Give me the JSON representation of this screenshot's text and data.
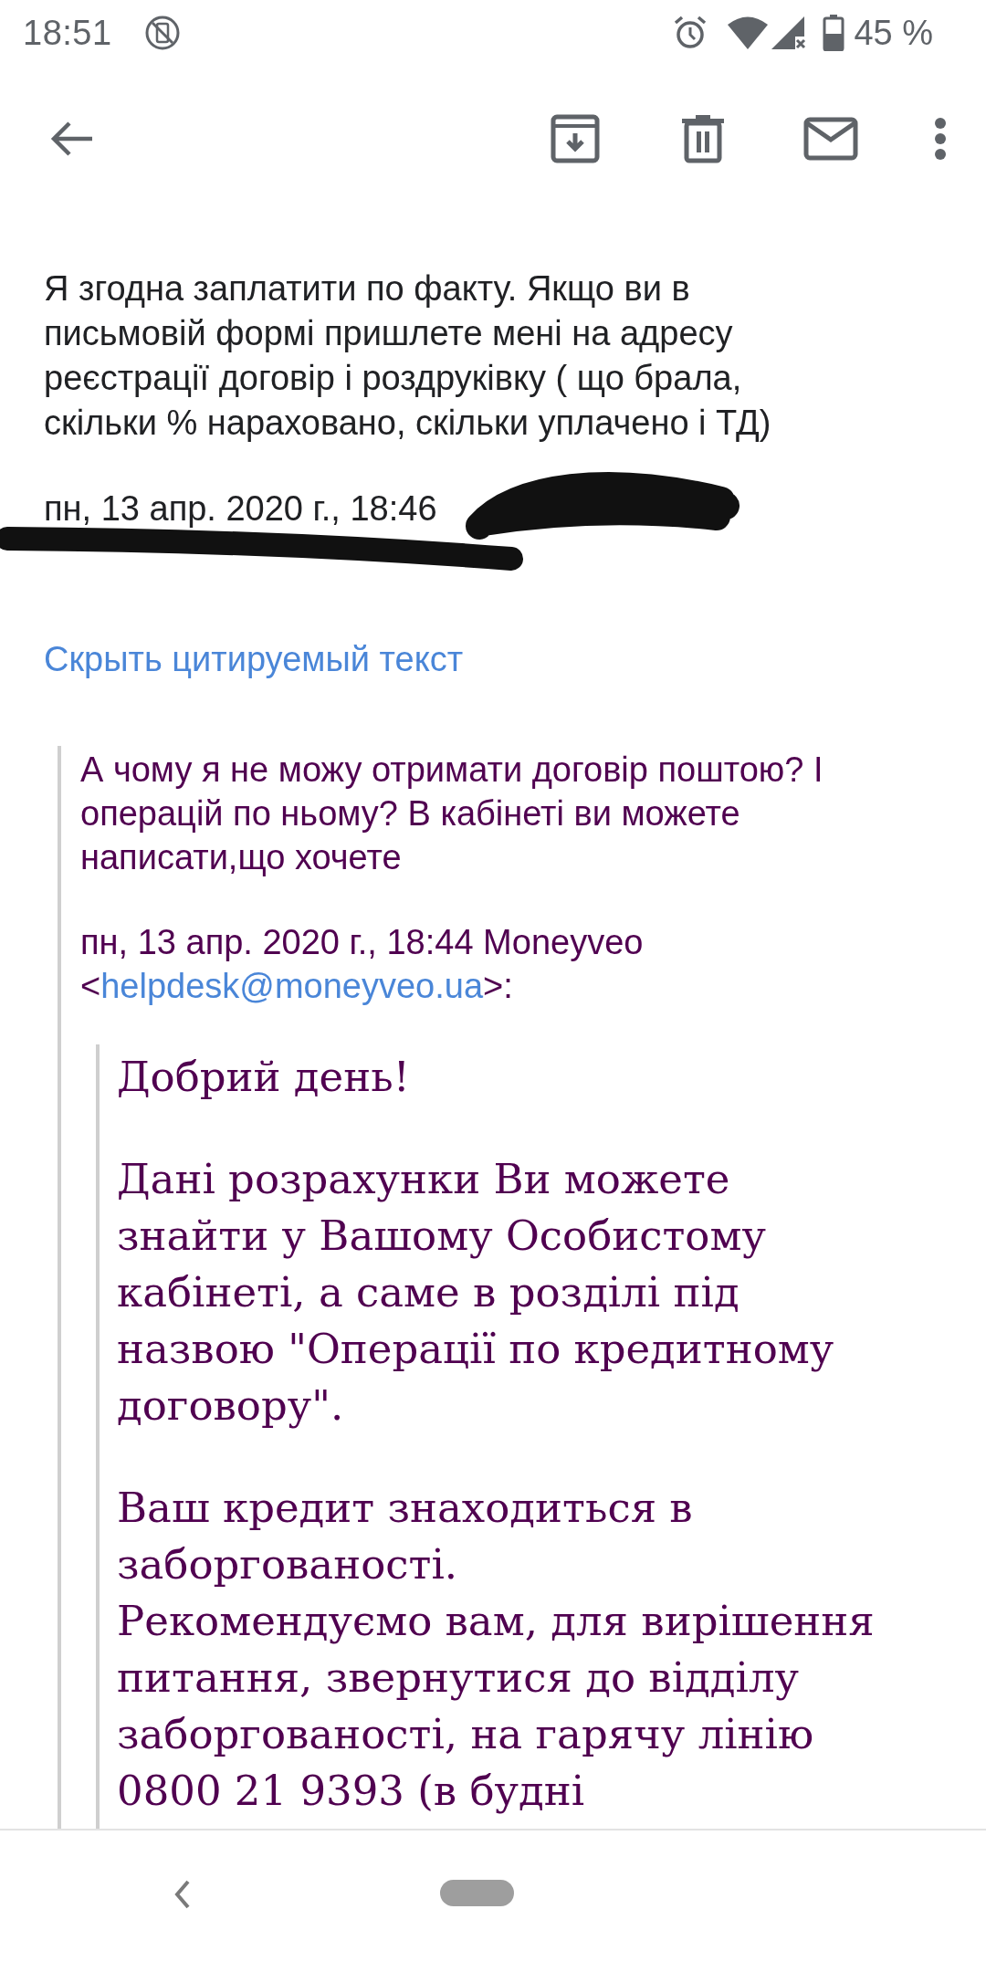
{
  "status_bar": {
    "time": "18:51",
    "battery_percent": "45 %"
  },
  "message": {
    "body": "Я згодна заплатити по факту. Якщо ви в письмовій формі пришлете мені на адресу реєстрації договір і роздруківку ( що брала, скільки % нараховано, скільки уплачено і ТД)",
    "date": "пн, 13 апр. 2020 г., 18:46",
    "hide_quoted_link": "Скрыть цитируемый текст"
  },
  "quote": {
    "text": "А чому я не можу отримати договір поштою? І операцій по ньому? В кабінеті ви можете написати,що хочете",
    "attribution": {
      "prefix": "пн, 13 апр. 2020 г., 18:44 Moneyveo <",
      "email": "helpdesk@moneyveo.ua",
      "suffix": ">:"
    },
    "nested_quote": {
      "paragraphs": [
        [
          "Добрий день!"
        ],
        [
          "Дані розрахунки Ви можете знайти у Вашому Особистому кабінеті, а саме в розділі під назвою \"Операції по кредитному договору\"."
        ],
        [
          "Ваш кредит знаходиться в заборгованості.",
          "Рекомендуємо вам, для вирішення питання, звернутися до відділу заборгованості, на гарячу лінію 0800 21 9393 (в будні"
        ]
      ]
    }
  }
}
